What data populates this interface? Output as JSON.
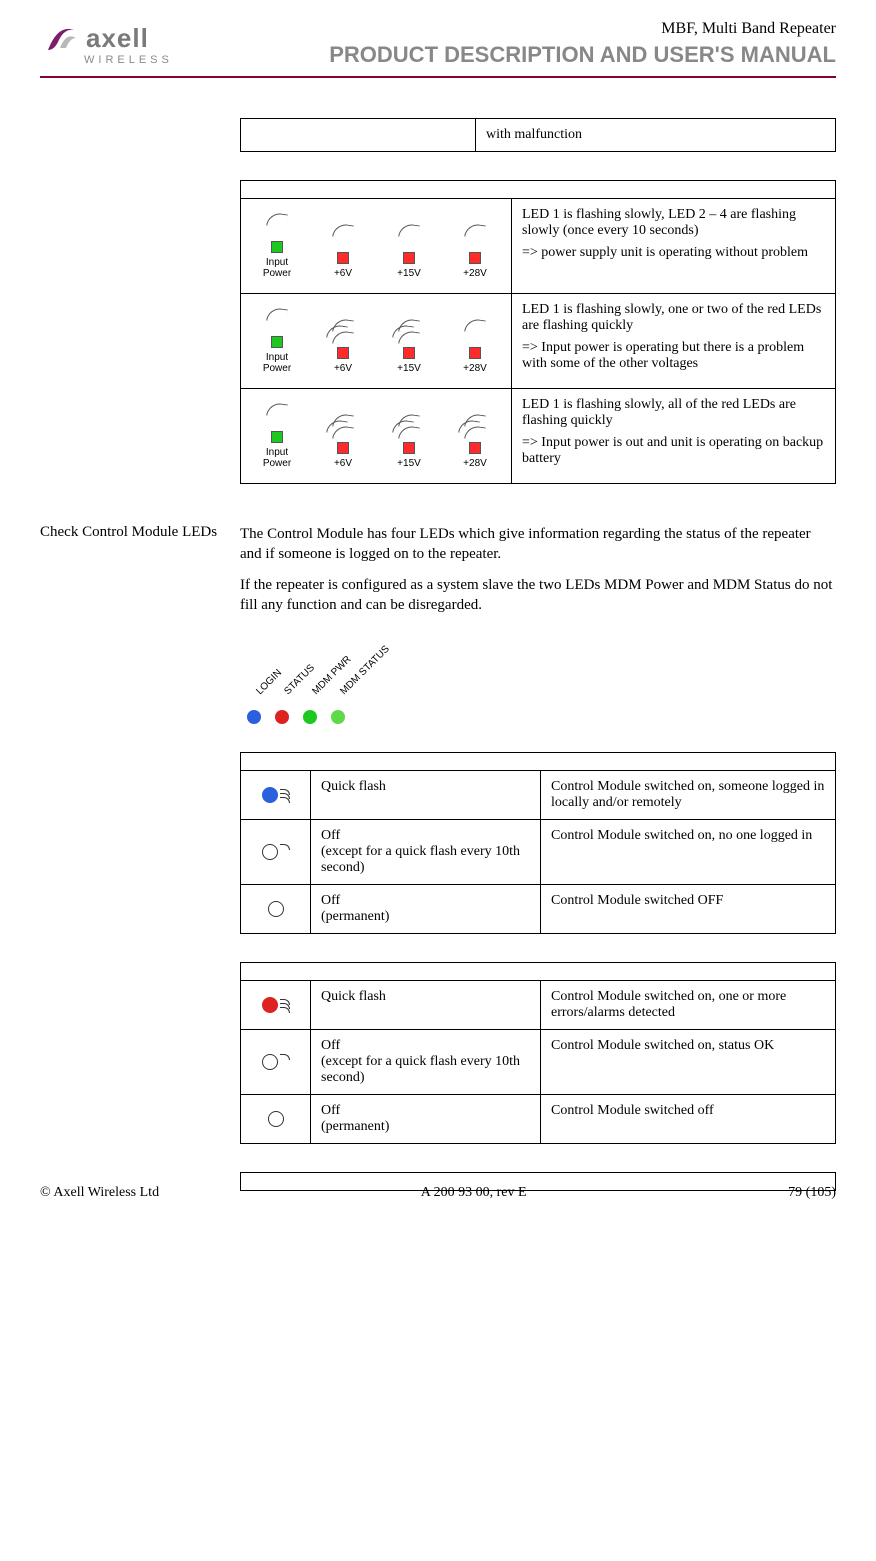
{
  "header": {
    "brand_top": "axell",
    "brand_bottom": "WIRELESS",
    "product": "MBF, Multi Band Repeater",
    "manual": "PRODUCT DESCRIPTION AND USER'S MANUAL"
  },
  "fragment_row": {
    "right": "with malfunction"
  },
  "psu_leds": {
    "labels": {
      "l1": "Input Power",
      "l2": "+6V",
      "l3": "+15V",
      "l4": "+28V"
    },
    "rows": [
      {
        "desc_line1": "LED 1 is flashing slowly, LED 2 – 4 are flashing slowly (once every 10 seconds)",
        "desc_line2": "=> power supply unit is operating without problem"
      },
      {
        "desc_line1": "LED 1 is flashing slowly, one or two of  the red LEDs are flashing quickly",
        "desc_line2": "=> Input power is operating but there is a problem with some of the other voltages"
      },
      {
        "desc_line1": "LED 1 is flashing slowly, all of  the red LEDs are flashing quickly",
        "desc_line2": "=> Input power is out and unit is operating on backup battery"
      }
    ]
  },
  "section": {
    "heading": "Check Control Module LEDs",
    "p1": "The Control Module has four LEDs which give information regarding the status of the repeater and if someone is logged on to the repeater.",
    "p2": "If the repeater is configured as a system slave the two LEDs MDM Power and MDM Status do not fill any function and can be disregarded."
  },
  "ctrl_led_labels": {
    "a": "LOGIN",
    "b": "STATUS",
    "c": "MDM PWR",
    "d": "MDM STATUS"
  },
  "login_table": {
    "rows": [
      {
        "state": "Quick flash",
        "meaning": "Control Module switched on, someone logged in locally and/or remotely"
      },
      {
        "state": "Off\n(except for a quick flash every 10th second)",
        "meaning": "Control Module switched on, no one logged in"
      },
      {
        "state": "Off\n(permanent)",
        "meaning": "Control Module switched OFF"
      }
    ]
  },
  "status_table": {
    "rows": [
      {
        "state": "Quick flash",
        "meaning": "Control Module switched on, one or more errors/alarms detected"
      },
      {
        "state": "Off\n(except for a quick flash every 10th second)",
        "meaning": "Control Module switched on, status OK"
      },
      {
        "state": "Off\n(permanent)",
        "meaning": "Control Module switched off"
      }
    ]
  },
  "footer": {
    "left": "© Axell Wireless Ltd",
    "center": "A 200 93 00, rev E",
    "right": "79 (105)"
  }
}
